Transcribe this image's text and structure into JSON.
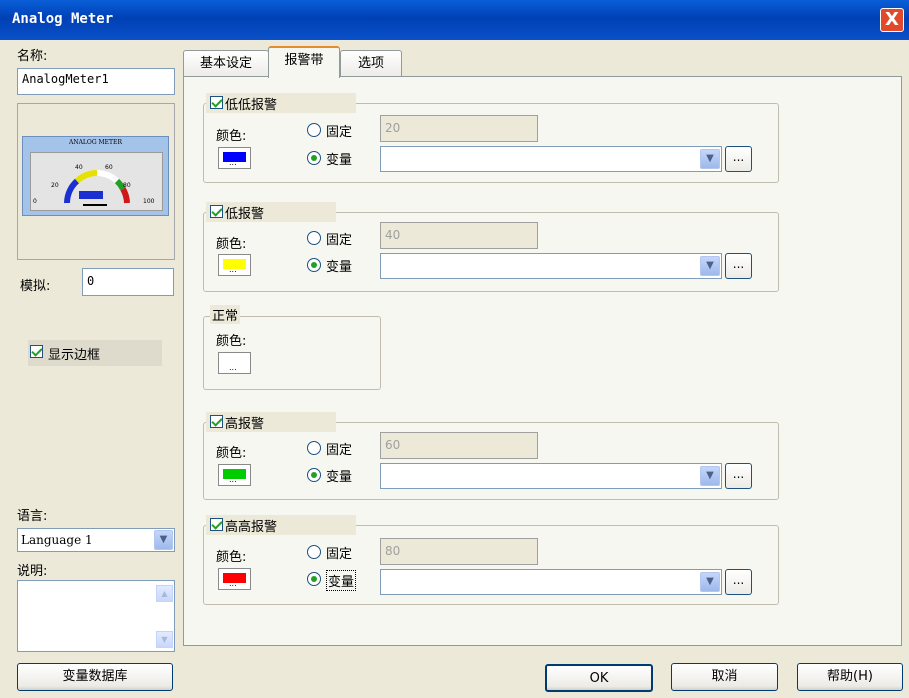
{
  "window": {
    "title": "Analog Meter",
    "close_glyph": "X"
  },
  "left": {
    "name_label": "名称:",
    "name_value": "AnalogMeter1",
    "preview": {
      "title": "ANALOG METER",
      "ticks": [
        "0",
        "20",
        "40",
        "60",
        "80",
        "100"
      ]
    },
    "simulate_label": "模拟:",
    "simulate_value": "0",
    "show_border_label": "显示边框",
    "language_label": "语言:",
    "language_value": "Language 1",
    "description_label": "说明:",
    "tag_db_button": "变量数据库"
  },
  "tabs": [
    {
      "label": "基本设定"
    },
    {
      "label": "报警带"
    },
    {
      "label": "选项"
    }
  ],
  "alarm_bands": [
    {
      "title": "低低报警",
      "checked": true,
      "color_label": "颜色:",
      "fixed_label": "固定",
      "var_label": "变量",
      "fixed_value": "20",
      "color": "#0000FF"
    },
    {
      "title": "低报警",
      "checked": true,
      "color_label": "颜色:",
      "fixed_label": "固定",
      "var_label": "变量",
      "fixed_value": "40",
      "color": "#FFFF00"
    },
    {
      "title": "高报警",
      "checked": true,
      "color_label": "颜色:",
      "fixed_label": "固定",
      "var_label": "变量",
      "fixed_value": "60",
      "color": "#00CC00"
    },
    {
      "title": "高高报警",
      "checked": true,
      "color_label": "颜色:",
      "fixed_label": "固定",
      "var_label": "变量",
      "fixed_value": "80",
      "color": "#FF0000"
    }
  ],
  "normal_band": {
    "title": "正常",
    "color_label": "颜色:",
    "color": "#FFFFFF"
  },
  "ellipsis": "...",
  "buttons": {
    "ok": "OK",
    "cancel": "取消",
    "help": "帮助(H)"
  }
}
